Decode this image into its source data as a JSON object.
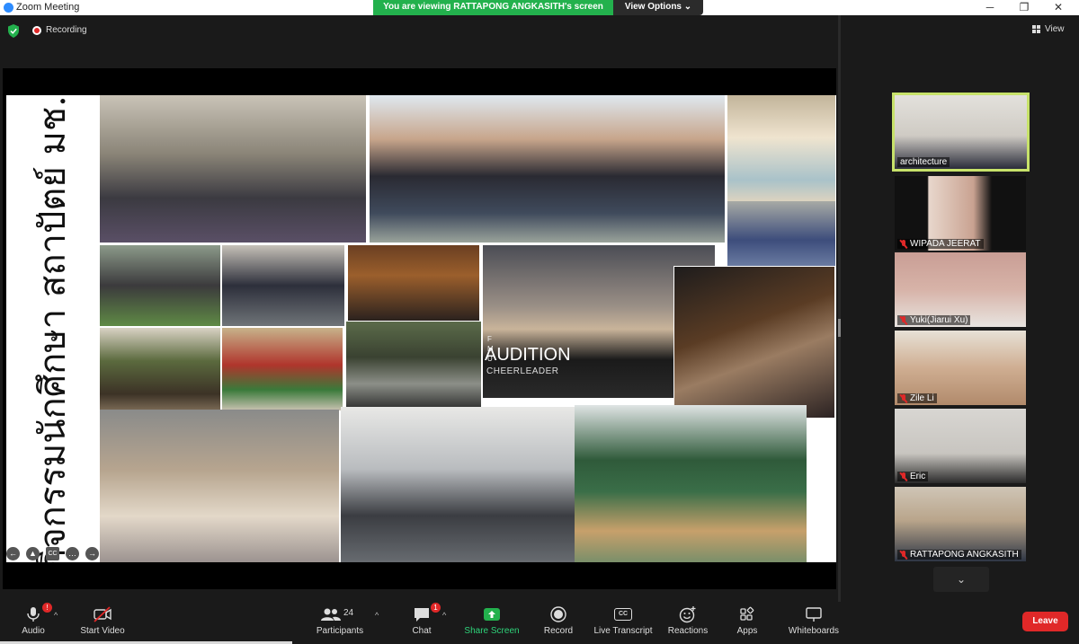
{
  "window": {
    "title": "Zoom Meeting",
    "minimize": "─",
    "maximize": "❐",
    "close": "✕"
  },
  "share_banner": {
    "text": "You are viewing RATTAPONG ANGKASITH's screen",
    "view_options": "View Options",
    "view_options_caret": "⌄",
    "color": "#23b14d"
  },
  "top_bar": {
    "recording": "Recording",
    "view": "View"
  },
  "slide": {
    "title": "กิจกรรมนักศึกษา สถาปัตย์ มช.",
    "audition": "AUDITION",
    "cheerleader": "CHEERLEADER",
    "fmu": "F M U",
    "controls": [
      "←",
      "▲",
      "CC",
      "…",
      "→"
    ]
  },
  "participants": [
    {
      "name": "architecture",
      "active": true,
      "muted": false,
      "color": "#d7d4cf"
    },
    {
      "name": "WIPADA JEERAT",
      "active": false,
      "muted": true,
      "color": "#c9b3a4"
    },
    {
      "name": "Yuki(Jiarui Xu)",
      "active": false,
      "muted": true,
      "color": "#caa39a"
    },
    {
      "name": "Zile Li",
      "active": false,
      "muted": true,
      "color": "#cbb7a1"
    },
    {
      "name": "Eric",
      "active": false,
      "muted": true,
      "color": "#d3d0cb"
    },
    {
      "name": "RATTAPONG ANGKASITH",
      "active": false,
      "muted": true,
      "color": "#bfb6a8"
    }
  ],
  "toolbar": {
    "audio": "Audio",
    "audio_badge": "!",
    "start_video": "Start Video",
    "participants": "Participants",
    "participants_count": "24",
    "chat": "Chat",
    "chat_badge": "1",
    "share_screen": "Share Screen",
    "record": "Record",
    "live_transcript": "Live Transcript",
    "cc": "CC",
    "reactions": "Reactions",
    "apps": "Apps",
    "whiteboards": "Whiteboards",
    "leave": "Leave",
    "caret": "^",
    "leave_color": "#e02828"
  }
}
